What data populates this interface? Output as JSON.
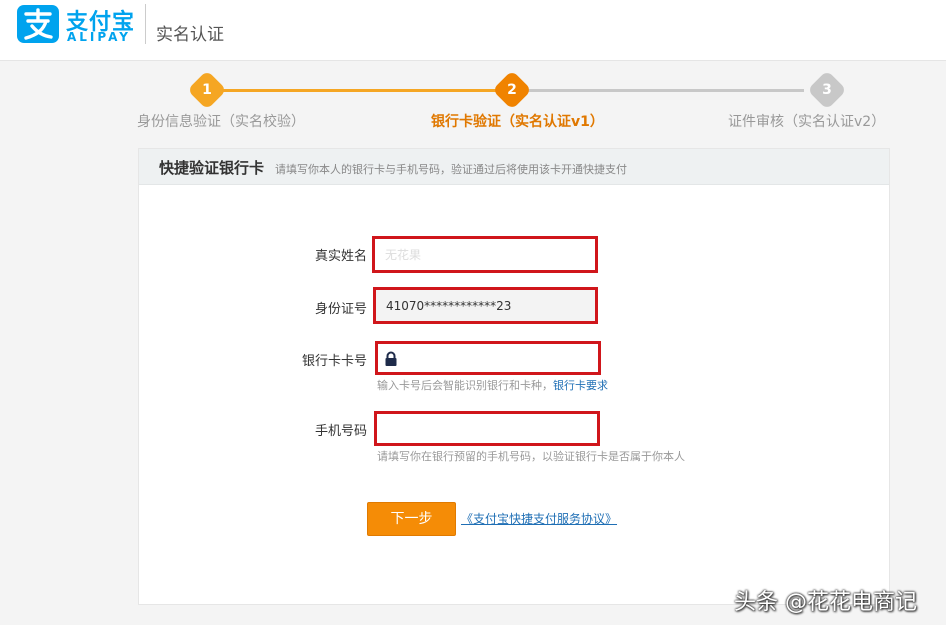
{
  "header": {
    "logo_cn": "支付宝",
    "logo_en": "ALIPAY",
    "page_title": "实名认证"
  },
  "steps": [
    {
      "number": "1",
      "label": "身份信息验证（实名校验）"
    },
    {
      "number": "2",
      "label": "银行卡验证（实名认证v1）"
    },
    {
      "number": "3",
      "label": "证件审核（实名认证v2）"
    }
  ],
  "panel": {
    "title": "快捷验证银行卡",
    "description": "请填写你本人的银行卡与手机号码，验证通过后将使用该卡开通快捷支付"
  },
  "form": {
    "name_label": "真实姓名",
    "name_placeholder": "无花果",
    "id_label": "身份证号",
    "id_value": "41070************23",
    "card_label": "银行卡卡号",
    "card_hint": "输入卡号后会智能识别银行和卡种，",
    "card_hint_link": "银行卡要求",
    "phone_label": "手机号码",
    "phone_hint": "请填写你在银行预留的手机号码，以验证银行卡是否属于你本人"
  },
  "actions": {
    "next_label": "下一步",
    "agreement_link": "《支付宝快捷支付服务协议》"
  },
  "watermark": "头条 @花花电商记",
  "colors": {
    "brand_blue": "#00a3ee",
    "step_orange": "#f5a623",
    "step_inactive": "#c8c8c8",
    "button_orange": "#f58c06",
    "highlight_red": "#d0161b",
    "link_blue": "#1f6fb5"
  }
}
